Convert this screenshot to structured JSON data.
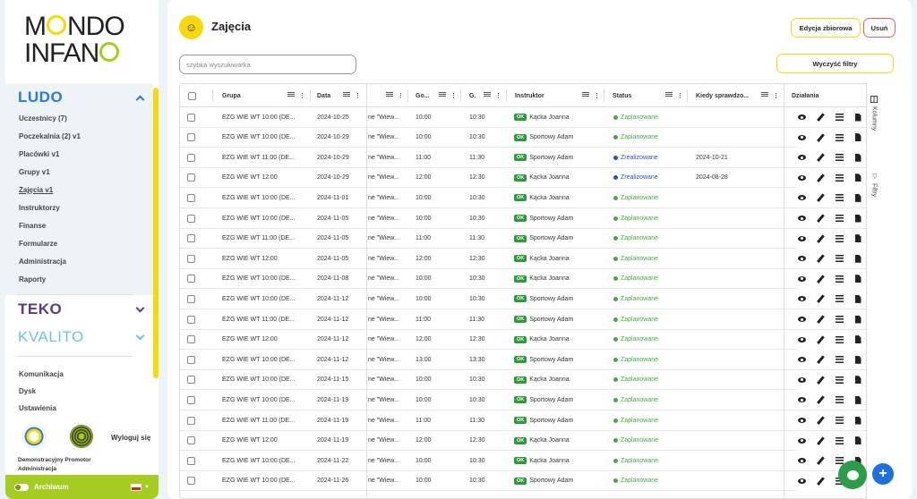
{
  "brand": {
    "line1": "MONDO",
    "line2": "INFANO"
  },
  "sidebar": {
    "ludo": {
      "title": "LUDO",
      "items": [
        {
          "label": "Uczestnicy (7)"
        },
        {
          "label": "Poczekalnia (2) v1"
        },
        {
          "label": "Placówki v1"
        },
        {
          "label": "Grupy v1"
        },
        {
          "label": "Zajęcia v1"
        },
        {
          "label": "Instruktorzy"
        },
        {
          "label": "Finanse"
        },
        {
          "label": "Formularze"
        },
        {
          "label": "Administracja"
        },
        {
          "label": "Raporty"
        }
      ]
    },
    "teko": {
      "title": "TEKO"
    },
    "kvalito": {
      "title": "KVALITO"
    },
    "bottom_items": [
      {
        "label": "Komunikacja"
      },
      {
        "label": "Dysk"
      },
      {
        "label": "Ustawienia"
      }
    ],
    "logout": "Wyloguj się",
    "user_name": "Demonstracyjny Promotor",
    "user_role": "Administracja",
    "archive": "Archiwum"
  },
  "page": {
    "title": "Zajęcia",
    "edit_bulk": "Edycja zbiorowa",
    "delete": "Usuń",
    "clear_filters": "Wyczyść filtry",
    "search_placeholder": "szybka wyszukiwarka"
  },
  "table": {
    "headers": {
      "group": "Grupa",
      "date": "Data",
      "start": "Go...",
      "end": "G.",
      "instructor": "Instruktor",
      "status": "Status",
      "checked": "Kiedy sprawdzo...",
      "actions": "Działania"
    },
    "rows": [
      {
        "group": "EZG WIE WT 10:00 (DE...",
        "date": "2024-10-25",
        "place": "ne \"Wiew...",
        "start": "10:00",
        "end": "10:30",
        "instructor": "Kącka Joanna",
        "status": "Zaplanowane",
        "checked": ""
      },
      {
        "group": "EZG WIE WT 10:00 (DE...",
        "date": "2024-10-29",
        "place": "ne \"Wiew...",
        "start": "10:00",
        "end": "10:30",
        "instructor": "Sportowy Adam",
        "status": "Zaplanowane",
        "checked": ""
      },
      {
        "group": "EZG WIE WT 11:00 (DE...",
        "date": "2024-10-29",
        "place": "ne \"Wiew...",
        "start": "11:00",
        "end": "11:30",
        "instructor": "Sportowy Adam",
        "status": "Zrealizowane",
        "checked": "2024-10-21"
      },
      {
        "group": "EZG WIE WT 12:00",
        "date": "2024-10-29",
        "place": "ne \"Wiew...",
        "start": "12:00",
        "end": "12:30",
        "instructor": "Kącka Joanna",
        "status": "Zrealizowane",
        "checked": "2024-08-28"
      },
      {
        "group": "EZG WIE WT 10:00 (DE...",
        "date": "2024-11-01",
        "place": "ne \"Wiew...",
        "start": "10:00",
        "end": "10:30",
        "instructor": "Kącka Joanna",
        "status": "Zaplanowane",
        "checked": ""
      },
      {
        "group": "EZG WIE WT 10:00 (DE...",
        "date": "2024-11-05",
        "place": "ne \"Wiew...",
        "start": "10:00",
        "end": "10:30",
        "instructor": "Sportowy Adam",
        "status": "Zaplanowane",
        "checked": ""
      },
      {
        "group": "EZG WIE WT 11:00 (DE...",
        "date": "2024-11-05",
        "place": "ne \"Wiew...",
        "start": "11:00",
        "end": "11:30",
        "instructor": "Sportowy Adam",
        "status": "Zaplanowane",
        "checked": ""
      },
      {
        "group": "EZG WIE WT 12:00",
        "date": "2024-11-05",
        "place": "ne \"Wiew...",
        "start": "12:00",
        "end": "12:30",
        "instructor": "Kącka Joanna",
        "status": "Zaplanowane",
        "checked": ""
      },
      {
        "group": "EZG WIE WT 10:00 (DE...",
        "date": "2024-11-08",
        "place": "ne \"Wiew...",
        "start": "10:00",
        "end": "10:30",
        "instructor": "Kącka Joanna",
        "status": "Zaplanowane",
        "checked": ""
      },
      {
        "group": "EZG WIE WT 10:00 (DE...",
        "date": "2024-11-12",
        "place": "ne \"Wiew...",
        "start": "10:00",
        "end": "10:30",
        "instructor": "Sportowy Adam",
        "status": "Zaplanowane",
        "checked": ""
      },
      {
        "group": "EZG WIE WT 11:00 (DE...",
        "date": "2024-11-12",
        "place": "ne \"Wiew...",
        "start": "11:00",
        "end": "11:30",
        "instructor": "Sportowy Adam",
        "status": "Zaplanowane",
        "checked": ""
      },
      {
        "group": "EZG WIE WT 12:00",
        "date": "2024-11-12",
        "place": "ne \"Wiew...",
        "start": "12:00",
        "end": "12:30",
        "instructor": "Kącka Joanna",
        "status": "Zaplanowane",
        "checked": ""
      },
      {
        "group": "EZG WIE WT 10:00 (DE...",
        "date": "2024-11-12",
        "place": "ne \"Wiew...",
        "start": "13:00",
        "end": "13:30",
        "instructor": "Sportowy Adam",
        "status": "Zaplanowane",
        "checked": ""
      },
      {
        "group": "EZG WIE WT 10:00 (DE...",
        "date": "2024-11-15",
        "place": "ne \"Wiew...",
        "start": "10:00",
        "end": "10:30",
        "instructor": "Kącka Joanna",
        "status": "Zaplanowane",
        "checked": ""
      },
      {
        "group": "EZG WIE WT 10:00 (DE...",
        "date": "2024-11-19",
        "place": "ne \"Wiew...",
        "start": "10:00",
        "end": "10:30",
        "instructor": "Sportowy Adam",
        "status": "Zaplanowane",
        "checked": ""
      },
      {
        "group": "EZG WIE WT 11:00 (DE...",
        "date": "2024-11-19",
        "place": "ne \"Wiew...",
        "start": "11:00",
        "end": "11:30",
        "instructor": "Sportowy Adam",
        "status": "Zaplanowane",
        "checked": ""
      },
      {
        "group": "EZG WIE WT 12:00",
        "date": "2024-11-19",
        "place": "ne \"Wiew...",
        "start": "12:00",
        "end": "12:30",
        "instructor": "Kącka Joanna",
        "status": "Zaplanowane",
        "checked": ""
      },
      {
        "group": "EZG WIE WT 10:00 (DE...",
        "date": "2024-11-22",
        "place": "ne \"Wiew...",
        "start": "10:00",
        "end": "10:30",
        "instructor": "Kącka Joanna",
        "status": "Zaplanowane",
        "checked": ""
      },
      {
        "group": "EZG WIE WT 10:00 (DE...",
        "date": "2024-11-26",
        "place": "ne \"Wiew...",
        "start": "10:00",
        "end": "10:30",
        "instructor": "Sportowy Adam",
        "status": "Zaplanowane",
        "checked": ""
      }
    ]
  },
  "side_tabs": {
    "columns": "Kolumny",
    "filters": "Filtry"
  },
  "badge_ok": "OK",
  "colors": {
    "accent_yellow": "#f5d90a",
    "ludo_blue": "#2a7ad6",
    "ok_green": "#2e9b3a",
    "planned": "#45a845",
    "done": "#2a4fc4",
    "archive_green": "#a6cc22"
  }
}
